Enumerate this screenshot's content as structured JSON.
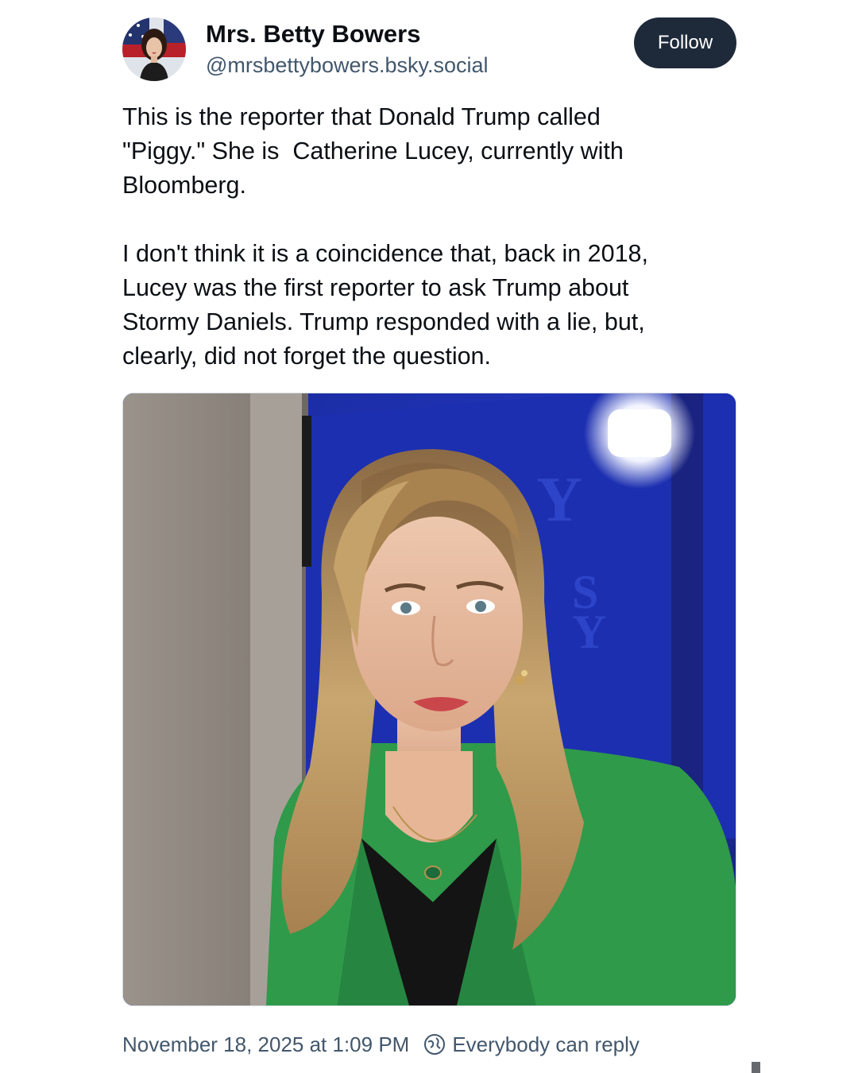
{
  "author": {
    "display_name": "Mrs. Betty Bowers",
    "handle": "@mrsbettybowers.bsky.social",
    "avatar_icon": "profile-avatar"
  },
  "actions": {
    "follow_label": "Follow"
  },
  "post": {
    "paragraph_1": [
      "This is the reporter that Donald Trump called",
      "\"Piggy.\" She is  Catherine Lucey, currently with",
      "Bloomberg."
    ],
    "paragraph_2": [
      "I don't think it is a coincidence that, back in 2018,",
      "Lucey was the first reporter to ask Trump about",
      "Stormy Daniels. Trump responded with a lie, but,",
      "clearly, did not forget the question."
    ]
  },
  "media": {
    "type": "photo",
    "subject": "woman-in-green-blazer-portrait"
  },
  "footer": {
    "timestamp": "November 18, 2025 at 1:09 PM",
    "reply_setting": "Everybody can reply",
    "reply_icon": "globe-icon"
  },
  "colors": {
    "text_primary": "#0b0f14",
    "text_secondary": "#42576c",
    "follow_button_bg": "#1e2a3a",
    "follow_button_text": "#ffffff",
    "media_border": "#d4dbe2"
  }
}
